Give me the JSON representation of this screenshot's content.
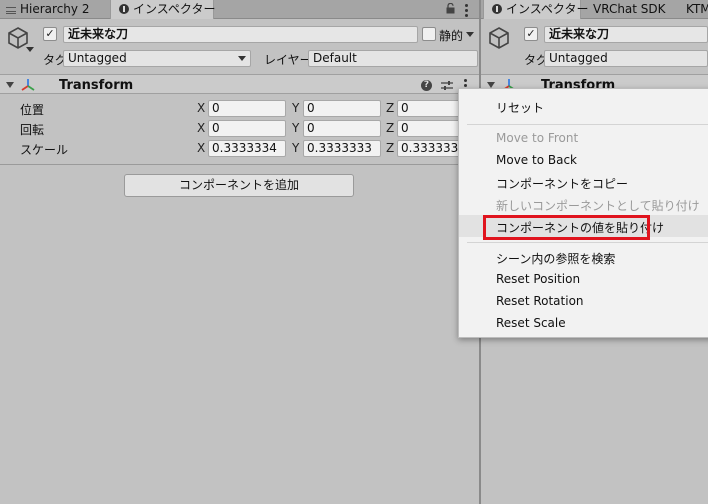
{
  "left_panel": {
    "tabs": [
      {
        "label": "Hierarchy 2",
        "icon": "hierarchy-icon"
      },
      {
        "label": "インスペクター",
        "icon": "info-icon"
      }
    ],
    "object_name": "近未来な刀",
    "active": true,
    "static_label": "静的",
    "tag_label": "タグ",
    "tag_value": "Untagged",
    "layer_label": "レイヤー",
    "layer_value": "Default",
    "component": {
      "title": "Transform",
      "rows": [
        {
          "label": "位置",
          "x": "0",
          "y": "0",
          "z": "0"
        },
        {
          "label": "回転",
          "x": "0",
          "y": "0",
          "z": "0"
        },
        {
          "label": "スケール",
          "x": "0.3333334",
          "y": "0.3333333",
          "z": "0.3333333"
        }
      ]
    },
    "axis_labels": {
      "x": "X",
      "y": "Y",
      "z": "Z"
    },
    "add_component_label": "コンポーネントを追加"
  },
  "right_panel": {
    "tabs": [
      {
        "label": "インスペクター",
        "icon": "info-icon"
      },
      {
        "label": "VRChat SDK"
      },
      {
        "label": "KTM"
      }
    ],
    "object_name": "近未来な刀",
    "tag_label": "タグ",
    "tag_value": "Untagged",
    "component_title": "Transform"
  },
  "context_menu": {
    "items": [
      {
        "label": "リセット",
        "enabled": true
      },
      {
        "label": "Move to Front",
        "enabled": false
      },
      {
        "label": "Move to Back",
        "enabled": true
      },
      {
        "label": "コンポーネントをコピー",
        "enabled": true
      },
      {
        "label": "新しいコンポーネントとして貼り付け",
        "enabled": false
      },
      {
        "label": "コンポーネントの値を貼り付け",
        "enabled": true,
        "highlighted": true
      },
      {
        "label": "シーン内の参照を検索",
        "enabled": true
      },
      {
        "label": "Reset Position",
        "enabled": true
      },
      {
        "label": "Reset Rotation",
        "enabled": true
      },
      {
        "label": "Reset Scale",
        "enabled": true
      }
    ]
  },
  "colors": {
    "highlight_border": "#e0141e",
    "panel_bg": "#c2c2c2",
    "menu_bg": "#f2f2f2"
  }
}
